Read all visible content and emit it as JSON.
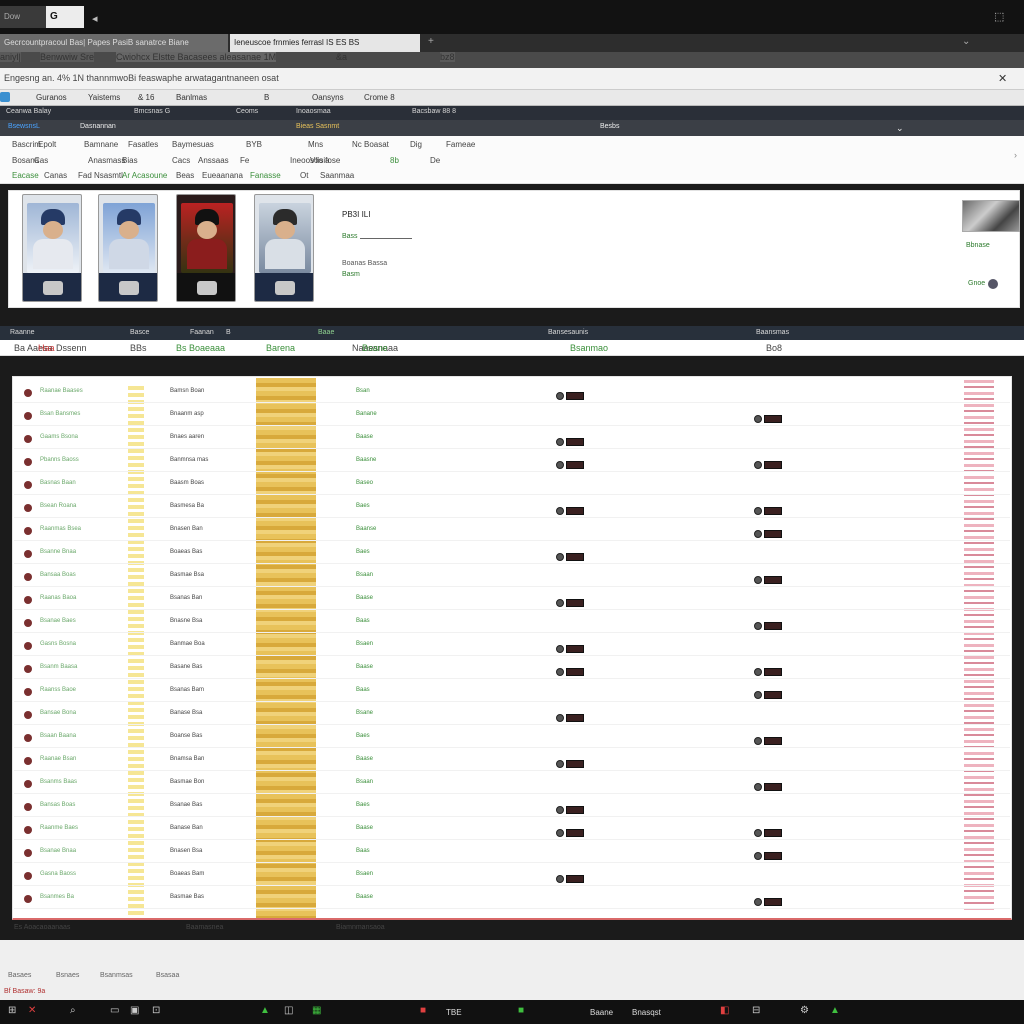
{
  "window": {
    "tab1": "Dow",
    "tab2": "G",
    "back": "◂",
    "icon_a": "⬚",
    "icon_b": "✕"
  },
  "browser_tabs": [
    {
      "label": "Gecrcountpracoul Bas| Papes PasiB sanatrce Biane"
    },
    {
      "label": "Ieneuscoe frnmies ferrasl IS ES BS"
    }
  ],
  "row2": [
    "aniyl|",
    "Benwwiw Sre",
    "Cwiohcx Elstte Bacasees aleasanae 1M",
    "&a",
    "bz8"
  ],
  "address": {
    "text": "Engesng an. 4% 1N thannmwoBi feaswaphe arwatagantnaneen osat",
    "close": "✕"
  },
  "toolbar": [
    "Guranos",
    "Yaistems",
    "& 16",
    "Banlmas",
    "B",
    "Oansyns",
    "Crome 8"
  ],
  "app_header": [
    "Ceanwa Balay",
    "Bmcsnas G",
    "Ceoms",
    "Inoaosmaa",
    "Bacsbaw 88 8"
  ],
  "app_header2": [
    "BsewsnsL",
    "Dasnannan",
    "Bieas Sasnmt",
    "Besbs",
    "Mabunavaaga Acas"
  ],
  "menu": {
    "row1": [
      "Bascrim",
      "Epolt",
      "Bamnane",
      "Fasatles",
      "Baymesuas",
      "BYB",
      "Mns",
      "Nc Boasat",
      "Dig",
      "Fameae"
    ],
    "row2": [
      "Bosana",
      "Cas",
      "Anasmass",
      "Bias",
      "Cacs",
      "Anssaas",
      "Fe",
      "Ineoosoo fose",
      "Vfisia",
      "8b",
      "De"
    ],
    "row3": [
      "Eacase",
      "Canas",
      "Fad Nsasmtl",
      "Ar Acasoune",
      "Beas",
      "Eueaanana",
      "Fanasse",
      "Ot",
      "Saanmaa"
    ]
  },
  "product": {
    "title": "PB3I ILI",
    "link": "Bass",
    "meta": "Boanas Bassa",
    "meta2": "Basm",
    "side1": "Bbnase",
    "side2": "Gnoe"
  },
  "table_header": [
    "Raanne",
    "Basce",
    "Faanan",
    "B",
    "Baae",
    "Bansesaunis",
    "Baansmas"
  ],
  "filter_row": [
    "Ba Aaesa",
    "Haa",
    "Dssenn",
    "BBs",
    "Bs Boaeaaa",
    "Barena",
    "Naaesnaaa",
    "Bsane",
    "Bsanmao",
    "Bo8"
  ],
  "rows": [
    {
      "a": "Raanae Baases",
      "b": "Bamsn Boan",
      "c": "Bsan"
    },
    {
      "a": "Bsan Bansmes",
      "b": "Bnaanm asp",
      "c": "Banane"
    },
    {
      "a": "Gaams Bsona",
      "b": "Bnaes aaren",
      "c": "Baase"
    },
    {
      "a": "Pbanns Baoss",
      "b": "Banmnsa mas",
      "c": "Baasne"
    },
    {
      "a": "Basnas Baan",
      "b": "Baasm Boas",
      "c": "Baseo"
    },
    {
      "a": "Bsean Roana",
      "b": "Basmesa Ba",
      "c": "Baes"
    },
    {
      "a": "Raanmas Bsea",
      "b": "Bnasen Ban",
      "c": "Baanse"
    },
    {
      "a": "Bsanne Bnaa",
      "b": "Boaeas Bas",
      "c": "Baes"
    },
    {
      "a": "Bansaa Boas",
      "b": "Basmae Bsa",
      "c": "Bsaan"
    },
    {
      "a": "Raanas Baoa",
      "b": "Bsanas Ban",
      "c": "Baase"
    },
    {
      "a": "Bsanae Baes",
      "b": "Bnasne Bsa",
      "c": "Baas"
    },
    {
      "a": "Gasns Bosna",
      "b": "Banmae Boa",
      "c": "Bsaen"
    },
    {
      "a": "Bsanm Baasa",
      "b": "Basane Bas",
      "c": "Baase"
    },
    {
      "a": "Raanss Baoe",
      "b": "Bsanas Bam",
      "c": "Baas"
    },
    {
      "a": "Bansae Bona",
      "b": "Banase Bsa",
      "c": "Bsane"
    },
    {
      "a": "Bsaan Baana",
      "b": "Boanse Bas",
      "c": "Baes"
    },
    {
      "a": "Raanae Bsan",
      "b": "Bnamsa Ban",
      "c": "Baase"
    },
    {
      "a": "Bsanms Baas",
      "b": "Basmae Bon",
      "c": "Bsaan"
    },
    {
      "a": "Bansas Boas",
      "b": "Bsanae Bas",
      "c": "Baes"
    },
    {
      "a": "Raanme Baes",
      "b": "Banase Ban",
      "c": "Baase"
    },
    {
      "a": "Bsanae Bnaa",
      "b": "Bnasen Bsa",
      "c": "Baas"
    },
    {
      "a": "Gasna Baoss",
      "b": "Boaeas Bam",
      "c": "Bsaen"
    },
    {
      "a": "Bsanmes Ba",
      "b": "Basmae Bas",
      "c": "Baase"
    }
  ],
  "table_footer": [
    "Es Aoacaoaanaas",
    "Baamasnea",
    "Biamnmansaoa"
  ],
  "bottom_row": [
    "Basaes",
    "Bsnaes",
    "Bsanmsas",
    "Bsasaa"
  ],
  "status": "Bf Basaw: 9a",
  "taskbar": {
    "icon1": "⊞",
    "icon2": "✕",
    "icon3": "⌕",
    "t1": "TBE",
    "t2": "Baane",
    "t3": "Bnasqst"
  }
}
